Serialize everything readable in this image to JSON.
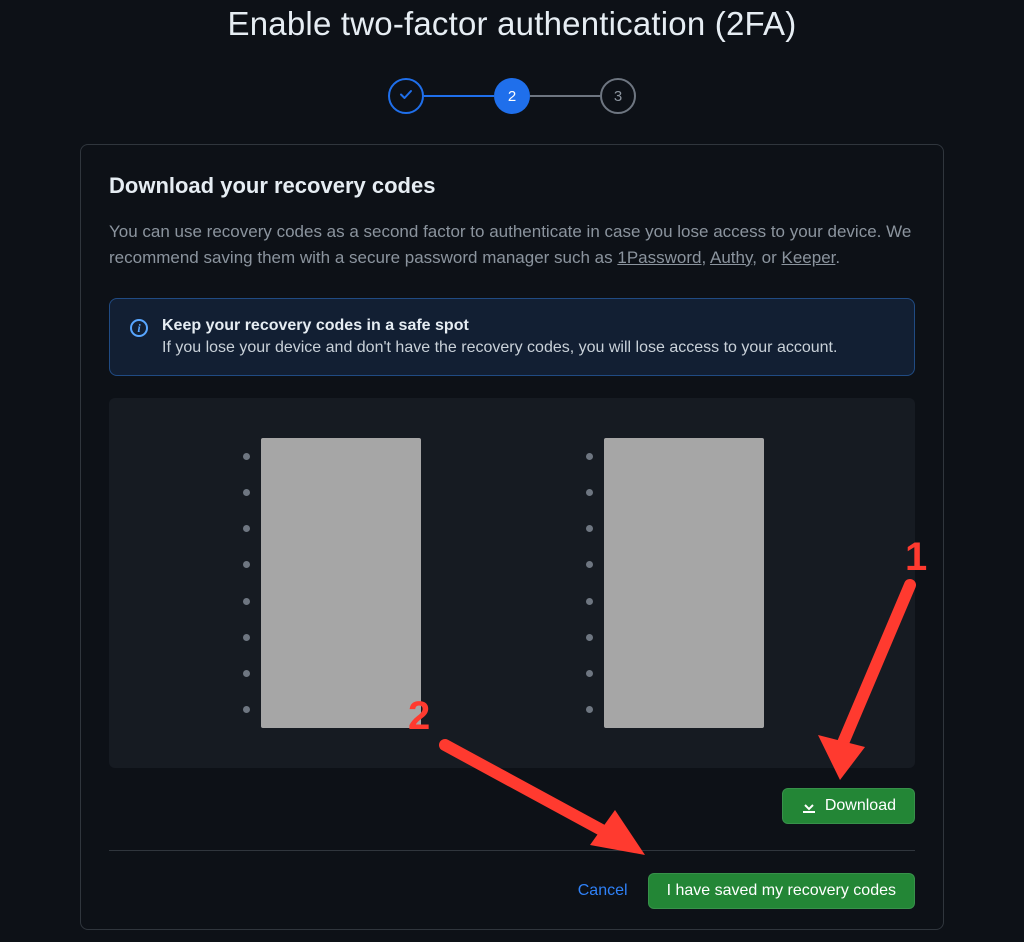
{
  "title": "Enable two-factor authentication (2FA)",
  "stepper": {
    "step1_label": "✓",
    "step2_label": "2",
    "step3_label": "3"
  },
  "section": {
    "heading": "Download your recovery codes",
    "description_pre": "You can use recovery codes as a second factor to authenticate in case you lose access to your device. We recommend saving them with a secure password manager such as ",
    "link_1password": "1Password",
    "sep1": ", ",
    "link_authy": "Authy",
    "sep2": ", or ",
    "link_keeper": "Keeper",
    "description_post": "."
  },
  "notice": {
    "title": "Keep your recovery codes in a safe spot",
    "body": "If you lose your device and don't have the recovery codes, you will lose access to your account."
  },
  "recovery_codes": {
    "column1_count": 8,
    "column2_count": 8,
    "redacted": true
  },
  "buttons": {
    "download": "Download",
    "cancel": "Cancel",
    "confirm": "I have saved my recovery codes"
  },
  "annotations": {
    "label1": "1",
    "label2": "2"
  }
}
